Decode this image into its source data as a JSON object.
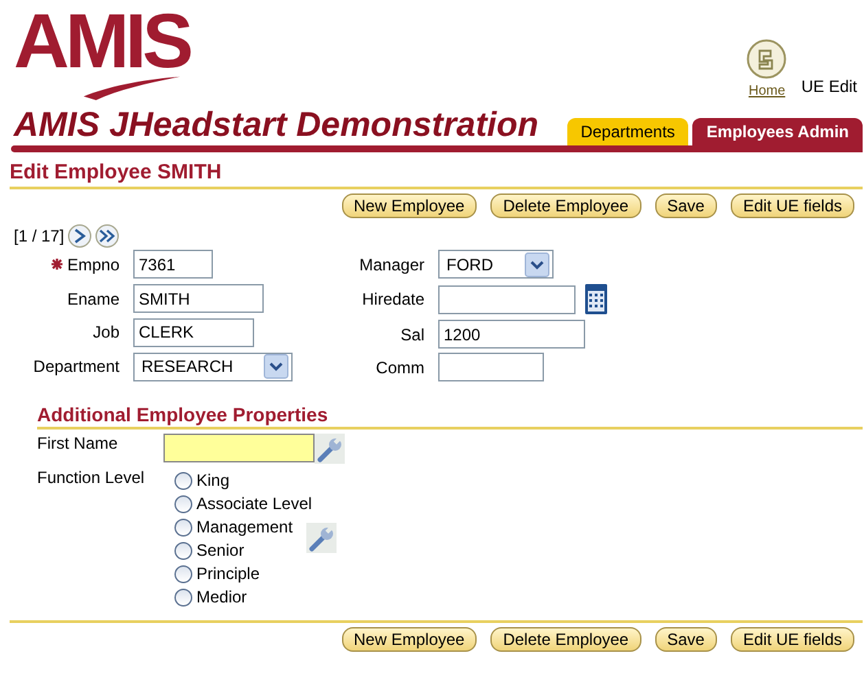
{
  "header": {
    "logo": "AMIS",
    "title": "AMIS JHeadstart Demonstration",
    "home_link": "Home",
    "user_label": "UE Edit",
    "tabs": [
      {
        "label": "Departments",
        "selected": false
      },
      {
        "label": "Employees Admin",
        "selected": true
      }
    ]
  },
  "page_title": "Edit Employee SMITH",
  "top_buttons": [
    "New Employee",
    "Delete Employee",
    "Save",
    "Edit UE fields"
  ],
  "pager": {
    "text": "[1 / 17]"
  },
  "left_fields": [
    {
      "label": "Empno",
      "value": "7361",
      "kind": "text",
      "required": true
    },
    {
      "label": "Ename",
      "value": "SMITH",
      "kind": "text",
      "required": false
    },
    {
      "label": "Job",
      "value": "CLERK",
      "kind": "text",
      "required": false
    },
    {
      "label": "Department",
      "value": "RESEARCH",
      "kind": "select",
      "required": false
    }
  ],
  "right_fields": [
    {
      "label": "Manager",
      "value": "FORD",
      "kind": "select"
    },
    {
      "label": "Hiredate",
      "kind": "date"
    },
    {
      "label": "Sal",
      "value": "1200",
      "kind": "text"
    },
    {
      "label": "Comm",
      "kind": "text"
    }
  ],
  "additional": {
    "title": "Additional Employee Properties",
    "first_name_label": "First Name",
    "function_level_label": "Function Level",
    "options": [
      {
        "label": "King",
        "selected": false
      },
      {
        "label": "Associate Level",
        "selected": false
      },
      {
        "label": "Management",
        "selected": false
      },
      {
        "label": "Senior",
        "selected": false
      },
      {
        "label": "Principle",
        "selected": false
      },
      {
        "label": "Medior",
        "selected": false
      }
    ]
  },
  "bottom_buttons": [
    "New Employee",
    "Delete Employee",
    "Save",
    "Edit UE fields"
  ]
}
